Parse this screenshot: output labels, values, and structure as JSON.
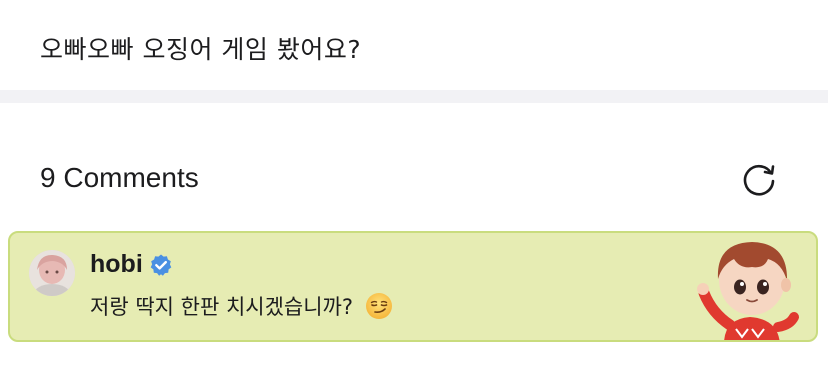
{
  "post": {
    "text": "오빠오빠 오징어 게임 봤어요?"
  },
  "comments_section": {
    "header": "9 Comments",
    "refresh_icon": "refresh-icon"
  },
  "comments": [
    {
      "author": "hobi",
      "verified": true,
      "text": "저랑 딱지 한판 치시겠습니까?",
      "emoji": "smirk-face-emoji",
      "highlight_color": "#e6ecb3",
      "highlight_border": "#c9dc7e",
      "sticker": "cartoon-character-sticker"
    }
  ],
  "colors": {
    "verified_badge": "#4a90e2",
    "divider": "#f2f2f5",
    "text": "#1c1c1e"
  }
}
